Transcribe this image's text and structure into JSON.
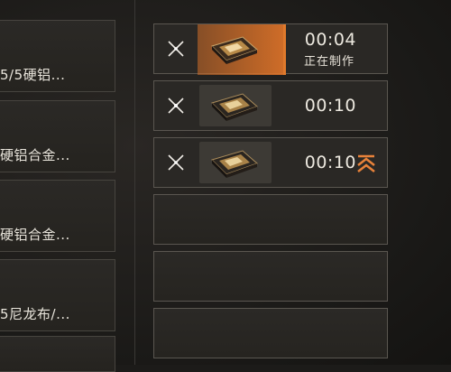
{
  "left_list": {
    "items": [
      {
        "label": "5/5硬铝..."
      },
      {
        "label": "硬铝合金..."
      },
      {
        "label": "硬铝合金..."
      },
      {
        "label": "5尼龙布/..."
      }
    ]
  },
  "queue": {
    "slots": [
      {
        "timer": "00:04",
        "status": "正在制作",
        "progress": 0.45,
        "icon": "circuit-board-icon",
        "state": "active"
      },
      {
        "timer": "00:10",
        "icon": "circuit-board-icon",
        "state": "queued"
      },
      {
        "timer": "00:10",
        "icon": "circuit-board-icon",
        "state": "queued",
        "priority_icon": "priority-chevron-icon"
      },
      {
        "state": "empty"
      },
      {
        "state": "empty"
      },
      {
        "state": "empty"
      }
    ]
  },
  "colors": {
    "accent": "#e07a2c",
    "priority": "#e8823a"
  }
}
